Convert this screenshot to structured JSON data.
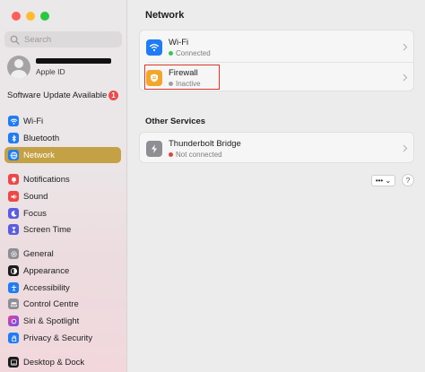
{
  "sidebar": {
    "search_placeholder": "Search",
    "account_label": "Apple ID",
    "update": {
      "label": "Software Update Available",
      "count": "1"
    },
    "items": [
      {
        "label": "Wi-Fi",
        "icon": "wifi-icon",
        "color": "#1f7cf5"
      },
      {
        "label": "Bluetooth",
        "icon": "bluetooth-icon",
        "color": "#1f7cf5"
      },
      {
        "label": "Network",
        "icon": "globe-icon",
        "color": "#1f7cf5",
        "active": true
      },
      {
        "label": "Notifications",
        "icon": "bell-icon",
        "color": "#ef4747"
      },
      {
        "label": "Sound",
        "icon": "speaker-icon",
        "color": "#ef4747"
      },
      {
        "label": "Focus",
        "icon": "moon-icon",
        "color": "#5c5ce0"
      },
      {
        "label": "Screen Time",
        "icon": "hourglass-icon",
        "color": "#5c5ce0"
      },
      {
        "label": "General",
        "icon": "gear-icon",
        "color": "#8e8e93"
      },
      {
        "label": "Appearance",
        "icon": "appearance-icon",
        "color": "#1c1c1e"
      },
      {
        "label": "Accessibility",
        "icon": "accessibility-icon",
        "color": "#1f7cf5"
      },
      {
        "label": "Control Centre",
        "icon": "control-centre-icon",
        "color": "#8e8e93"
      },
      {
        "label": "Siri & Spotlight",
        "icon": "siri-icon",
        "color": "#b44fd8"
      },
      {
        "label": "Privacy & Security",
        "icon": "hand-icon",
        "color": "#1f7cf5"
      },
      {
        "label": "Desktop & Dock",
        "icon": "dock-icon",
        "color": "#1c1c1e"
      }
    ]
  },
  "main": {
    "title": "Network",
    "services": [
      {
        "title": "Wi-Fi",
        "status": "Connected",
        "status_color": "#34c759",
        "icon": "wifi-icon",
        "icon_color": "#1f7cf5"
      },
      {
        "title": "Firewall",
        "status": "Inactive",
        "status_color": "#a0a0a0",
        "icon": "firewall-icon",
        "icon_color": "#f2a62b"
      }
    ],
    "other_title": "Other Services",
    "other_services": [
      {
        "title": "Thunderbolt Bridge",
        "status": "Not connected",
        "status_color": "#e0463b",
        "icon": "thunderbolt-icon",
        "icon_color": "#8e8e93"
      }
    ],
    "more_label": "••• ⌄",
    "help_label": "?"
  }
}
